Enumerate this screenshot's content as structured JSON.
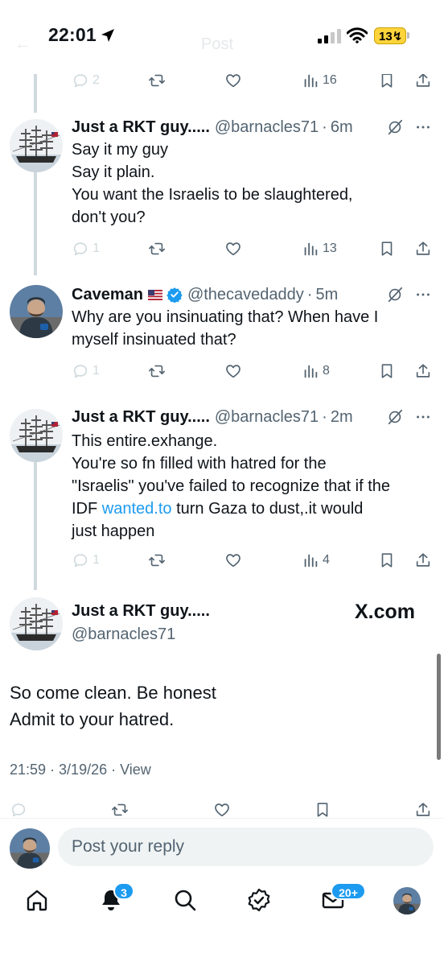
{
  "status_bar": {
    "time": "22:01",
    "battery": "13",
    "ghost_title": "Post"
  },
  "top_actions": {
    "reply_count": "2",
    "views": "16"
  },
  "tweets": [
    {
      "name": "Just a RKT guy.....",
      "handle": "@barnacles71",
      "age": "6m",
      "lines": [
        "Say it my guy",
        "Say it plain.",
        "You want the Israelis to be slaughtered,",
        "don't you?"
      ],
      "reply_count": "1",
      "views": "13"
    },
    {
      "name": "Caveman",
      "handle": "@thecavedaddy",
      "age": "5m",
      "lines": [
        "Why are you insinuating that? When have I",
        "myself insinuated that?"
      ],
      "reply_count": "1",
      "views": "8"
    },
    {
      "name": "Just a RKT guy.....",
      "handle": "@barnacles71",
      "age": "2m",
      "lines": [
        "This entire.exhange.",
        "You're so fn filled with hatred for the",
        "\"Israelis\" you've failed to recognize that if the"
      ],
      "last_line_prefix": "IDF ",
      "last_line_link": "wanted.to",
      "last_line_suffix": " turn Gaza to dust,.it would",
      "final_line": "just happen",
      "reply_count": "1",
      "views": "4"
    }
  ],
  "focused": {
    "name": "Just a RKT guy.....",
    "handle": "@barnacles71",
    "watermark": "X.com",
    "lines": [
      "So come clean. Be honest",
      "Admit to your hatred."
    ],
    "timestamp": "21:59 · 3/19/26 · ",
    "view_label": "View"
  },
  "reply": {
    "placeholder": "Post your reply"
  },
  "nav": {
    "notifications_badge": "3",
    "messages_badge": "20+"
  },
  "colors": {
    "accent": "#1d9bf0",
    "muted": "#536471",
    "thread_line": "#cfd9de"
  },
  "icons": [
    "location-arrow-icon",
    "signal-icon",
    "wifi-icon",
    "battery-icon",
    "reply-icon",
    "retweet-icon",
    "like-icon",
    "views-icon",
    "bookmark-icon",
    "share-icon",
    "grok-icon",
    "more-icon",
    "verified-icon",
    "flag-icon",
    "home-icon",
    "bell-icon",
    "search-icon",
    "communities-icon",
    "mail-icon"
  ]
}
